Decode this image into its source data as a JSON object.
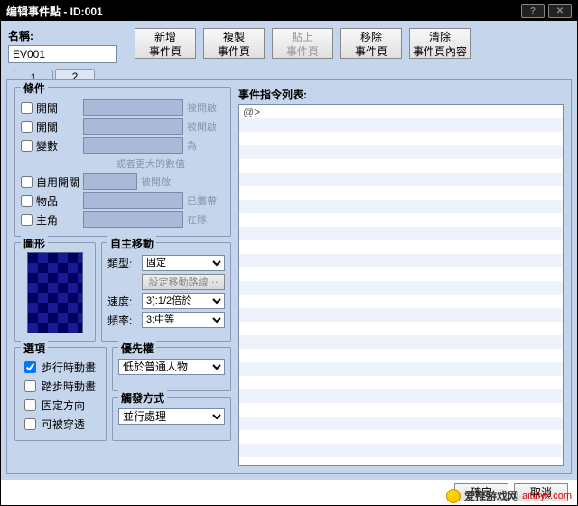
{
  "title": "编辑事件點 - ID:001",
  "name_label": "名稱:",
  "name_value": "EV001",
  "buttons": {
    "new": "新增\n事件頁",
    "copy": "複製\n事件頁",
    "paste": "貼上\n事件頁",
    "delete": "移除\n事件頁",
    "clear": "清除\n事件頁內容"
  },
  "tabs": [
    "1",
    "2"
  ],
  "cond": {
    "legend": "條件",
    "switch1": "開關",
    "switch1_hint": "被開啟",
    "switch2": "開關",
    "switch2_hint": "被開啟",
    "variable": "變數",
    "variable_hint": "為",
    "variable_sub": "或者更大的數值",
    "selfswitch": "自用開關",
    "selfswitch_hint": "被開啟",
    "item": "物品",
    "item_hint": "已攜帶",
    "actor": "主角",
    "actor_hint": "在隊"
  },
  "graphic_legend": "圖形",
  "move": {
    "legend": "自主移動",
    "type_label": "類型:",
    "type_value": "固定",
    "route_btn": "設定移動路線⋯",
    "speed_label": "速度:",
    "speed_value": "3):1/2倍於",
    "freq_label": "頻率:",
    "freq_value": "3:中等"
  },
  "options": {
    "legend": "選項",
    "walk": "步行時動畫",
    "step": "踏步時動畫",
    "dirfix": "固定方向",
    "through": "可被穿透"
  },
  "priority": {
    "legend": "優先權",
    "value": "低於普通人物"
  },
  "trigger": {
    "legend": "觸發方式",
    "value": "並行處理"
  },
  "cmd_label": "事件指令列表:",
  "cmd_first": "@>",
  "ok": "確定",
  "cancel": "取消",
  "site_name": "爱推游戏网",
  "site_url": "aituiyx.com"
}
